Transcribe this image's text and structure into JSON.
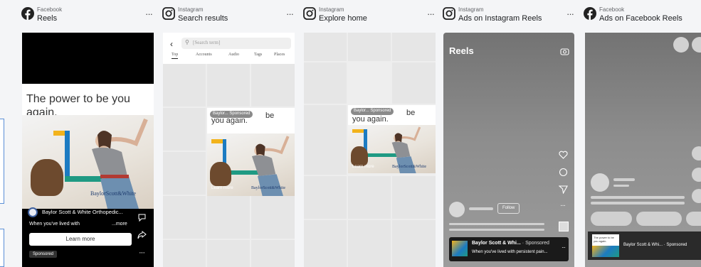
{
  "colors": {
    "facebook_blue": "#1877f2",
    "brand_navy": "#1d3b6e",
    "yellow": "#f2b31c",
    "blue": "#1c7bc2",
    "teal": "#1f9a83"
  },
  "cards": [
    {
      "platform": "Facebook",
      "placement": "Reels",
      "icon": "facebook-icon"
    },
    {
      "platform": "Instagram",
      "placement": "Search results",
      "icon": "instagram-icon"
    },
    {
      "platform": "Instagram",
      "placement": "Explore home",
      "icon": "instagram-icon"
    },
    {
      "platform": "Instagram",
      "placement": "Ads on Instagram Reels",
      "icon": "instagram-icon"
    },
    {
      "platform": "Facebook",
      "placement": "Ads on Facebook Reels",
      "icon": "facebook-icon"
    }
  ],
  "more_label": "···",
  "ad": {
    "headline": "The power to be you again.",
    "headline_short": "you again.",
    "brand_logo": "BaylorScott&White",
    "advertiser": "Baylor Scott & White Orthopedic...",
    "caption": "When you've lived with",
    "caption_more": "...more",
    "cta": "Learn more",
    "sponsored": "Sponsored"
  },
  "search": {
    "placeholder": "[Search term]",
    "tabs": [
      "Top",
      "Accounts",
      "Audio",
      "Tags",
      "Places"
    ]
  },
  "overlay": {
    "advertiser_short": "Baylor...",
    "sponsored": "Sponsored",
    "be": "be",
    "learn_more": "Learn more"
  },
  "ig_reels": {
    "title": "Reels",
    "follow": "Follow",
    "advertiser": "Baylor Scott & Whi...",
    "sponsored": "· Sponsored",
    "caption": "When you've lived with persistent pain..."
  },
  "fb_reels_ad": {
    "advertiser": "Baylor Scott & Whi... · Sponsored"
  }
}
